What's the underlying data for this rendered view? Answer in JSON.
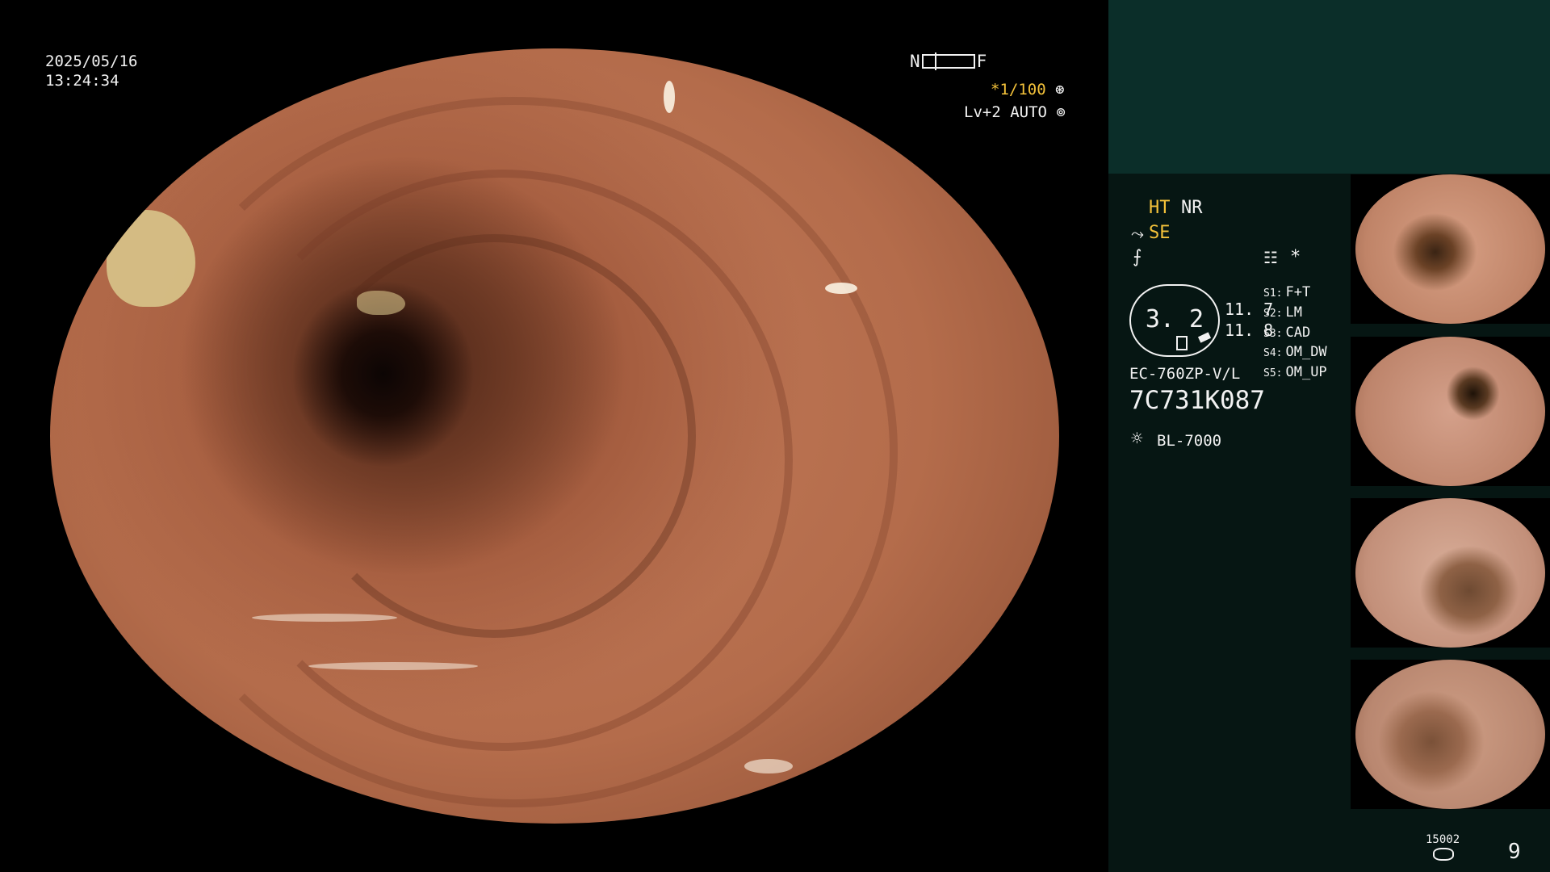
{
  "overlay": {
    "date": "2025/05/16",
    "time": "13:24:34",
    "near_label": "N",
    "far_label": "F",
    "zoom": "*1/100",
    "level": "Lv+2 AUTO"
  },
  "panel": {
    "ht": "HT",
    "nr": "NR",
    "se": "SE",
    "gauge_value": "3. 2",
    "value_a": "11. 7",
    "value_b": "11. 8",
    "star": "*",
    "slots": [
      {
        "key": "S1:",
        "value": "F+T"
      },
      {
        "key": "S2:",
        "value": "LM"
      },
      {
        "key": "S3:",
        "value": "CAD"
      },
      {
        "key": "S4:",
        "value": "OM_DW"
      },
      {
        "key": "S5:",
        "value": "OM_UP"
      }
    ],
    "scope_model": "EC-760ZP-V/L",
    "scope_serial": "7C731K087",
    "light_source": "BL-7000",
    "counter": "15002",
    "page_number": "9"
  },
  "colors": {
    "panel_bg": "#061613",
    "panel_header": "#0b2e29",
    "highlight": "#f4c23a",
    "text": "#f2f2f2"
  },
  "icons": {
    "se_icon": "⤳",
    "f_icon": "⨍",
    "doc_icon": "☷",
    "light_icon": "☼"
  }
}
